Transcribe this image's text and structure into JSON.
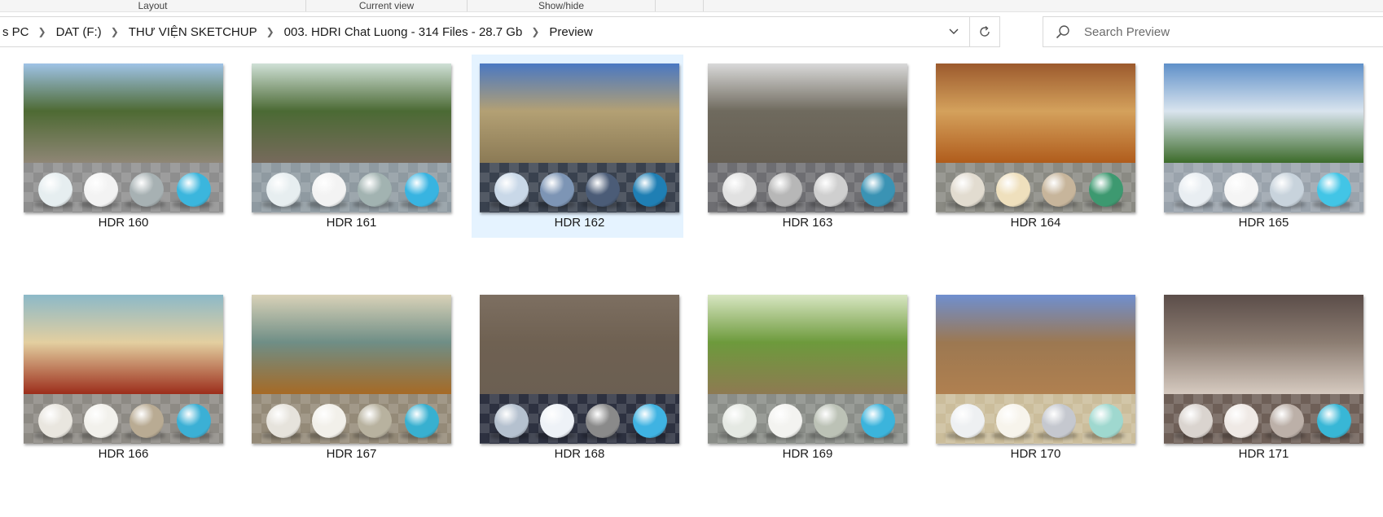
{
  "ribbon": {
    "groups": [
      "Layout",
      "Current view",
      "Show/hide",
      ""
    ]
  },
  "address": {
    "crumbs": [
      "s PC",
      "DAT  (F:)",
      "THƯ VIỆN SKETCHUP",
      "003. HDRI Chat Luong - 314 Files - 28.7 Gb",
      "Preview"
    ]
  },
  "search": {
    "placeholder": "Search Preview"
  },
  "files": [
    {
      "name": "HDR 160",
      "selected": false,
      "sky": "#9fc3e6",
      "mid": "#4e6a33",
      "ground": "#8f8676",
      "floor": "#8e8e8e",
      "balls": [
        "#e6eef0",
        "#f3f3f3",
        "#a7b1b3",
        "#3bb6dd"
      ]
    },
    {
      "name": "HDR 161",
      "selected": false,
      "sky": "#cfe0d6",
      "mid": "#4b6a34",
      "ground": "#776a5c",
      "floor": "#8f9aa1",
      "balls": [
        "#e7eef0",
        "#f3f3f3",
        "#a2b3b1",
        "#38b4e1"
      ]
    },
    {
      "name": "HDR 162",
      "selected": true,
      "sky": "#4a78c2",
      "mid": "#b3a074",
      "ground": "#8b7a55",
      "floor": "#39414e",
      "balls": [
        "#c9d8e8",
        "#7d95b5",
        "#4b5c77",
        "#1f7fb4"
      ]
    },
    {
      "name": "HDR 163",
      "selected": false,
      "sky": "#d9d9d9",
      "mid": "#6f6a5e",
      "ground": "#665f53",
      "floor": "#6e6e72",
      "balls": [
        "#e1e1e1",
        "#b7b7b7",
        "#cfcfcf",
        "#3a93b4"
      ]
    },
    {
      "name": "HDR 164",
      "selected": false,
      "sky": "#9c5a2d",
      "mid": "#d4a15c",
      "ground": "#b05c1c",
      "floor": "#8a8a83",
      "balls": [
        "#e2dcd0",
        "#efe0bd",
        "#c7b59b",
        "#3d9970"
      ]
    },
    {
      "name": "HDR 165",
      "selected": false,
      "sky": "#5f90c9",
      "mid": "#d9e4ee",
      "ground": "#3c6b2a",
      "floor": "#9aa3ac",
      "balls": [
        "#e9eef2",
        "#f5f5f5",
        "#c8d3dc",
        "#42c5e6"
      ]
    },
    {
      "name": "HDR 166",
      "selected": false,
      "sky": "#8cb9c8",
      "mid": "#e3cfa0",
      "ground": "#9c2d1b",
      "floor": "#8d8a84",
      "balls": [
        "#e9e6df",
        "#f2f1ec",
        "#b9ab93",
        "#3bb0d5"
      ]
    },
    {
      "name": "HDR 167",
      "selected": false,
      "sky": "#d9d2b8",
      "mid": "#6f8e86",
      "ground": "#a66a26",
      "floor": "#948a78",
      "balls": [
        "#e6e3dc",
        "#f2f0ea",
        "#b8b29f",
        "#38b0d0"
      ]
    },
    {
      "name": "HDR 168",
      "selected": false,
      "sky": "#7d6f61",
      "mid": "#6f6152",
      "ground": "#6b5f52",
      "floor": "#2d3140",
      "balls": [
        "#b5c1cf",
        "#eef2f7",
        "#8a8a8a",
        "#3fb3e2"
      ]
    },
    {
      "name": "HDR 169",
      "selected": false,
      "sky": "#d8e6c2",
      "mid": "#6d9a3c",
      "ground": "#8e7a52",
      "floor": "#8a8d88",
      "balls": [
        "#e5e9e3",
        "#f3f3f0",
        "#bcc2b6",
        "#3bb4dc"
      ]
    },
    {
      "name": "HDR 170",
      "selected": false,
      "sky": "#6f8fcf",
      "mid": "#9c7851",
      "ground": "#b08050",
      "floor": "#cbbd9b",
      "balls": [
        "#eef0f2",
        "#f7f4ec",
        "#c5c8cf",
        "#9fd8cf"
      ]
    },
    {
      "name": "HDR 171",
      "selected": false,
      "sky": "#5b4d49",
      "mid": "#8c7d72",
      "ground": "#d6cac0",
      "floor": "#6e5f57",
      "balls": [
        "#dad4cf",
        "#efe9e5",
        "#bcb0a8",
        "#38b7d6"
      ]
    }
  ]
}
